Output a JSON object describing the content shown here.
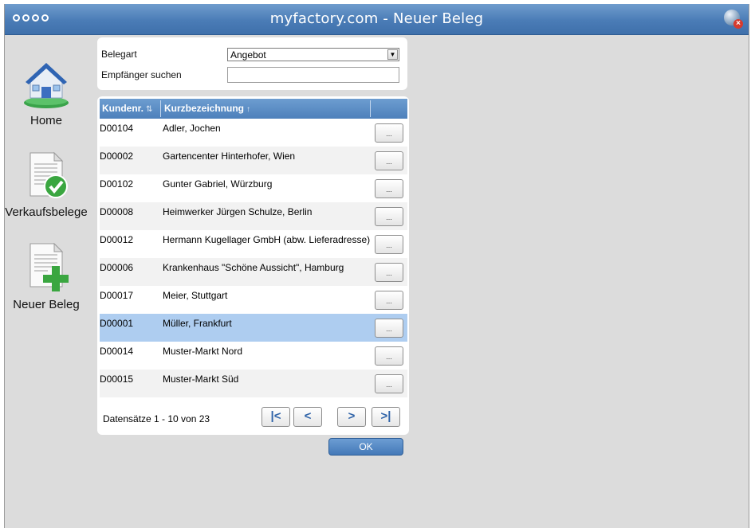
{
  "window": {
    "title": "myfactory.com - Neuer Beleg",
    "menu_icon": "four-dots-icon",
    "close_icon": "globe-close-icon"
  },
  "sidebar": {
    "items": [
      {
        "label": "Home",
        "icon": "house-icon"
      },
      {
        "label": "Verkaufsbelege",
        "icon": "document-check-icon"
      },
      {
        "label": "Neuer Beleg",
        "icon": "document-add-icon"
      }
    ]
  },
  "form": {
    "belegart_label": "Belegart",
    "belegart_value": "Angebot",
    "empfaenger_label": "Empfänger suchen",
    "empfaenger_value": "",
    "empfaenger_placeholder": ""
  },
  "table": {
    "columns": [
      "Kundenr.",
      "Kurzbezeichnung"
    ],
    "row_button_label": "...",
    "rows": [
      {
        "id": "D00104",
        "name": "Adler, Jochen"
      },
      {
        "id": "D00002",
        "name": "Gartencenter Hinterhofer, Wien"
      },
      {
        "id": "D00102",
        "name": "Gunter Gabriel, Würzburg"
      },
      {
        "id": "D00008",
        "name": "Heimwerker Jürgen Schulze, Berlin"
      },
      {
        "id": "D00012",
        "name": "Hermann Kugellager GmbH (abw. Lieferadresse)"
      },
      {
        "id": "D00006",
        "name": "Krankenhaus \"Schöne Aussicht\", Hamburg"
      },
      {
        "id": "D00017",
        "name": "Meier, Stuttgart"
      },
      {
        "id": "D00001",
        "name": "Müller, Frankfurt",
        "selected": true
      },
      {
        "id": "D00014",
        "name": "Muster-Markt Nord"
      },
      {
        "id": "D00015",
        "name": "Muster-Markt Süd"
      }
    ],
    "footer": "Datensätze 1 - 10 von 23",
    "pager": [
      "first-page-icon",
      "previous-page-icon",
      "next-page-icon",
      "last-page-icon"
    ]
  },
  "ok_label": "OK",
  "colors": {
    "accent": "#4a7cb6",
    "selected_row": "#aecdf0"
  }
}
